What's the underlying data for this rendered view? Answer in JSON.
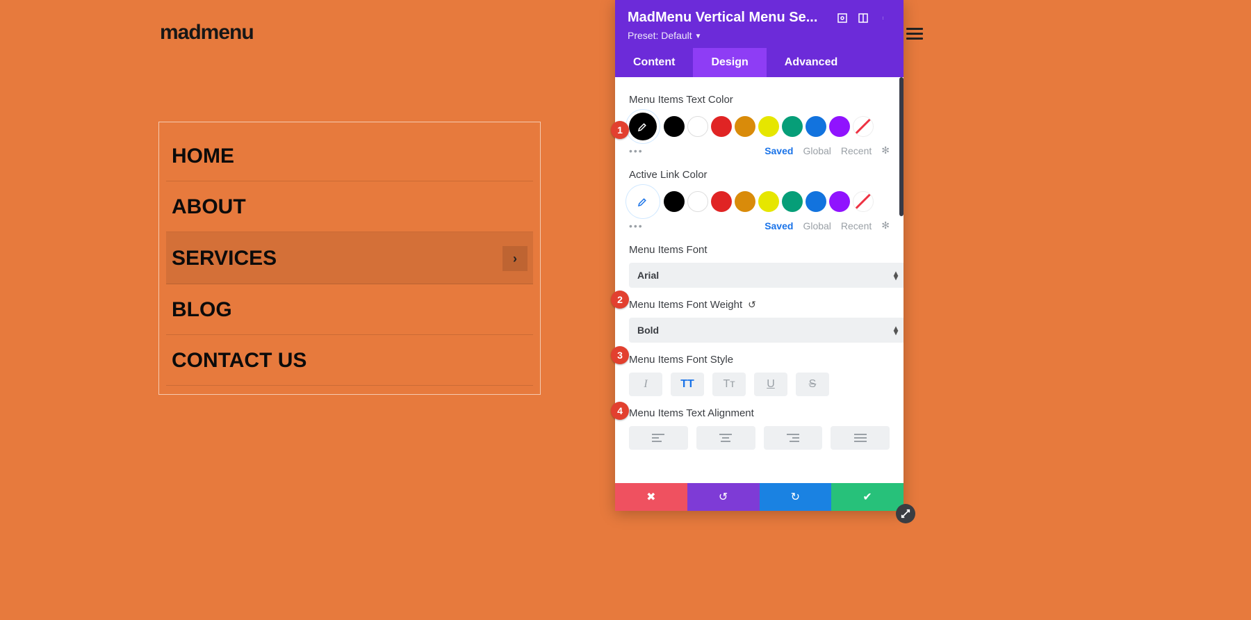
{
  "logo": "madmenu",
  "menu": {
    "items": [
      "HOME",
      "ABOUT",
      "SERVICES",
      "BLOG",
      "CONTACT US"
    ],
    "activeIndex": 2
  },
  "panel": {
    "title": "MadMenu Vertical Menu Se...",
    "preset": "Preset: Default",
    "tabs": {
      "content": "Content",
      "design": "Design",
      "advanced": "Advanced"
    },
    "labels": {
      "textColor": "Menu Items Text Color",
      "activeLink": "Active Link Color",
      "font": "Menu Items Font",
      "weight": "Menu Items Font Weight",
      "style": "Menu Items Font Style",
      "align": "Menu Items Text Alignment"
    },
    "meta": {
      "saved": "Saved",
      "global": "Global",
      "recent": "Recent"
    },
    "fontValue": "Arial",
    "weightValue": "Bold",
    "swatches": [
      "#000000",
      "#ffffff",
      "#e02424",
      "#d98b0a",
      "#e6e600",
      "#069e78",
      "#1273de",
      "#9013fe"
    ],
    "styleBtns": {
      "italic": "I",
      "upper": "TT",
      "small": "Tᴛ",
      "underline": "U",
      "strike": "S"
    }
  },
  "badges": [
    "1",
    "2",
    "3",
    "4"
  ]
}
